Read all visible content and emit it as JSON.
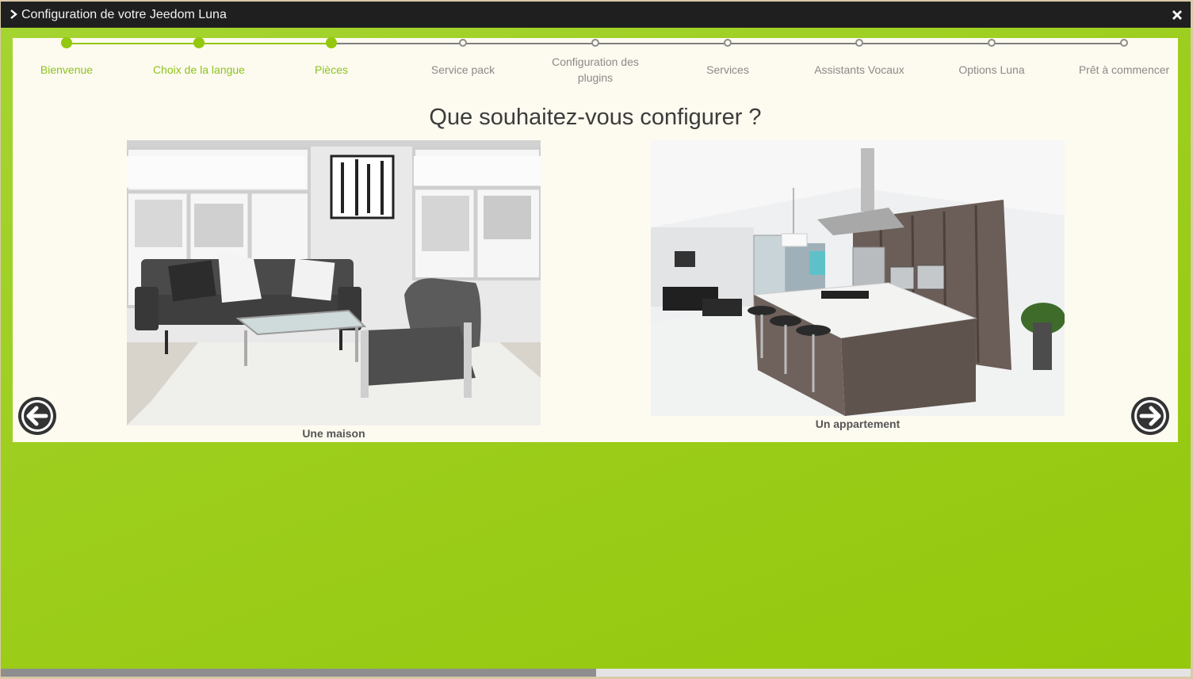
{
  "window": {
    "title": "Configuration de votre Jeedom Luna",
    "chevron_icon": "chevron-right-icon",
    "close_icon": "close-icon"
  },
  "colors": {
    "accent": "#93c80c",
    "titlebar": "#1f1f1f",
    "panel": "#fdfaef",
    "inactive": "#8a8a8a"
  },
  "wizard": {
    "steps": [
      {
        "label": "Bienvenue",
        "done": true
      },
      {
        "label": "Choix de la langue",
        "done": true
      },
      {
        "label": "Pièces",
        "done": true
      },
      {
        "label": "Service pack",
        "done": false
      },
      {
        "label": "Configuration des plugins",
        "done": false
      },
      {
        "label": "Services",
        "done": false
      },
      {
        "label": "Assistants Vocaux",
        "done": false
      },
      {
        "label": "Options Luna",
        "done": false
      },
      {
        "label": "Prêt à commencer",
        "done": false
      }
    ]
  },
  "main": {
    "question": "Que souhaitez-vous configurer ?",
    "choices": [
      {
        "label": "Une maison",
        "image": "living-room-photo"
      },
      {
        "label": "Un appartement",
        "image": "kitchen-photo"
      }
    ],
    "prev_icon": "arrow-left-circle-icon",
    "next_icon": "arrow-right-circle-icon"
  },
  "scrollbar": {
    "position_fraction": 0.0,
    "visible_fraction": 0.5
  }
}
